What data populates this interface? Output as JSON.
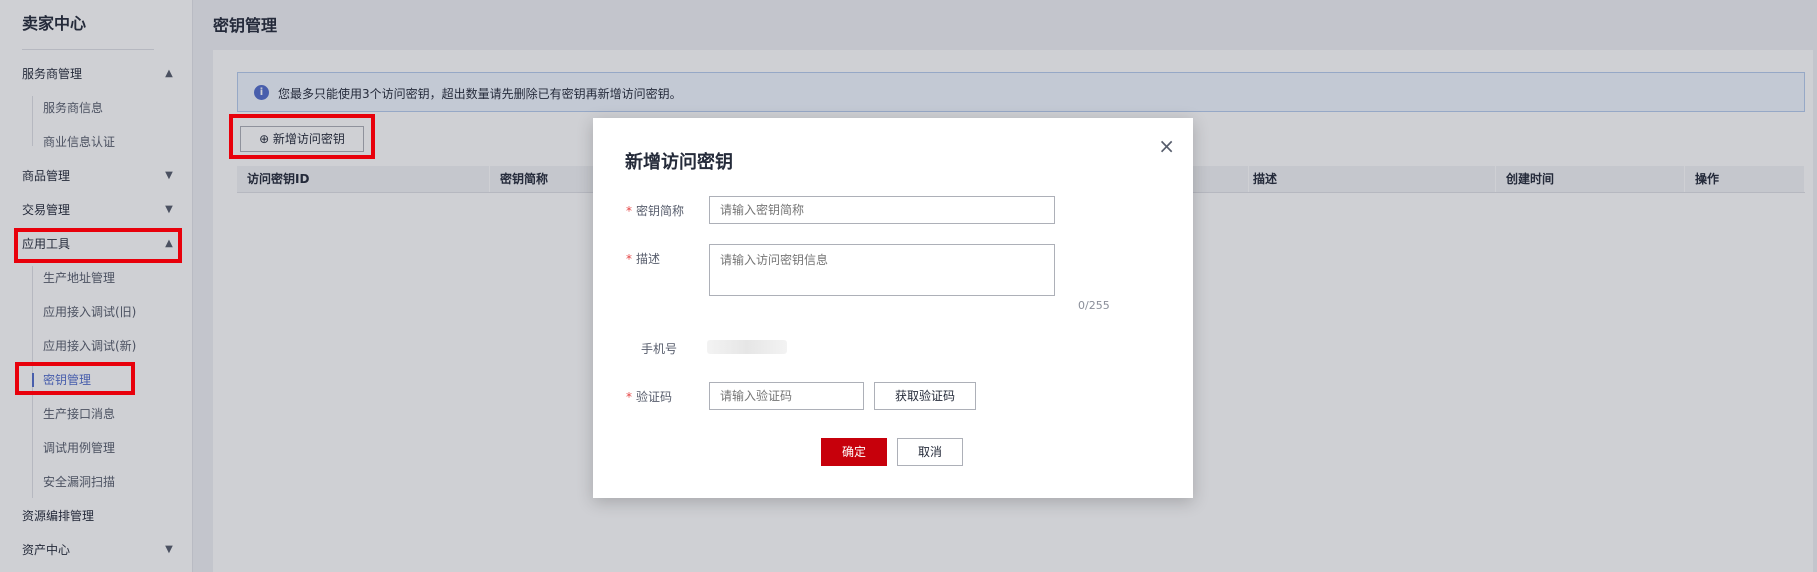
{
  "sidebar": {
    "title": "卖家中心",
    "groups": [
      {
        "label": "服务商管理",
        "arrow": "▲"
      },
      {
        "label": "商品管理",
        "arrow": "▼"
      },
      {
        "label": "交易管理",
        "arrow": "▼"
      },
      {
        "label": "应用工具",
        "arrow": "▲"
      },
      {
        "label": "资源编排管理",
        "arrow": ""
      },
      {
        "label": "资产中心",
        "arrow": "▼"
      }
    ],
    "sub_provider": [
      "服务商信息",
      "商业信息认证"
    ],
    "sub_tools": [
      "生产地址管理",
      "应用接入调试(旧)",
      "应用接入调试(新)",
      "密钥管理",
      "生产接口消息",
      "调试用例管理",
      "安全漏洞扫描"
    ]
  },
  "main": {
    "title": "密钥管理",
    "info_icon": "i",
    "info": "您最多只能使用3个访问密钥，超出数量请先删除已有密钥再新增访问密钥。",
    "add_button": "⊕ 新增访问密钥",
    "columns": [
      "访问密钥ID",
      "密钥简称",
      "描述",
      "创建时间",
      "操作"
    ]
  },
  "dialog": {
    "title": "新增访问密钥",
    "close": "×",
    "required_mark": "*",
    "name_label": "密钥简称",
    "name_placeholder": "请输入密钥简称",
    "desc_label": "描述",
    "desc_placeholder": "请输入访问密钥信息",
    "desc_counter": "0/255",
    "phone_label": "手机号",
    "code_label": "验证码",
    "code_placeholder": "请输入验证码",
    "get_code": "获取验证码",
    "confirm": "确定",
    "cancel": "取消"
  },
  "colors": {
    "accent": "#526ecc",
    "danger": "#c7000b",
    "highlight": "#e8000b"
  }
}
